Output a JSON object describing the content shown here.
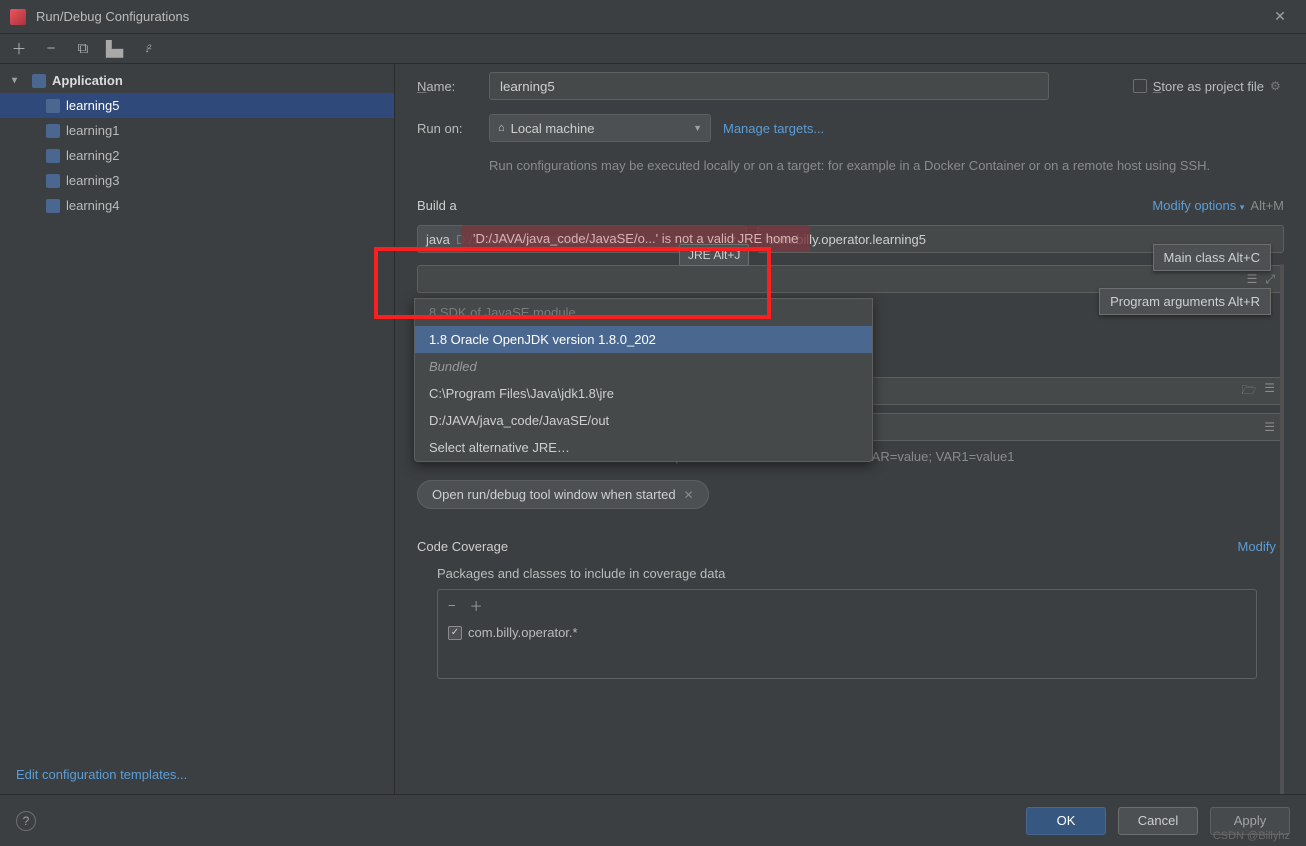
{
  "window": {
    "title": "Run/Debug Configurations"
  },
  "sidebar": {
    "header": "Application",
    "items": [
      "learning5",
      "learning1",
      "learning2",
      "learning3",
      "learning4"
    ],
    "templates_link": "Edit configuration templates..."
  },
  "form": {
    "name_label": "Name:",
    "name_value": "learning5",
    "store_label": "Store as project file",
    "runon_label": "Run on:",
    "runon_value": "Local machine",
    "manage_targets": "Manage targets...",
    "runon_desc": "Run configurations may be executed locally or on a target: for example in a Docker Container or on a remote host using SSH."
  },
  "build": {
    "title": "Build a",
    "modify": "Modify options",
    "modify_shortcut": "Alt+M",
    "jre_prefix": "java",
    "jre_path": "D:/JAVA/java_code/JavaSE/out",
    "main_class": "com.billy.operator.learning5",
    "error_toast": "'D:/JAVA/java_code/JavaSE/o...' is not a valid JRE home",
    "jre_tip": "JRE Alt+J",
    "mainclass_hint": "Main class Alt+C",
    "progargs_hint": "Program arguments Alt+R",
    "dropdown": {
      "truncated_top": "8  SDK of  JavaSE  module",
      "selected": "1.8 Oracle OpenJDK version 1.8.0_202",
      "bundled": "Bundled",
      "opt1": "C:\\Program Files\\Java\\jdk1.8\\jre",
      "opt2": "D:/JAVA/java_code/JavaSE/out",
      "select_alt": "Select alternative JRE…"
    },
    "env_hint": "Separate variables with semicolon: VAR=value; VAR1=value1",
    "pill": "Open run/debug tool window when started"
  },
  "coverage": {
    "title": "Code Coverage",
    "modify": "Modify",
    "subtitle": "Packages and classes to include in coverage data",
    "item": "com.billy.operator.*"
  },
  "footer": {
    "ok": "OK",
    "cancel": "Cancel",
    "apply": "Apply",
    "watermark": "CSDN @Billyhz"
  }
}
